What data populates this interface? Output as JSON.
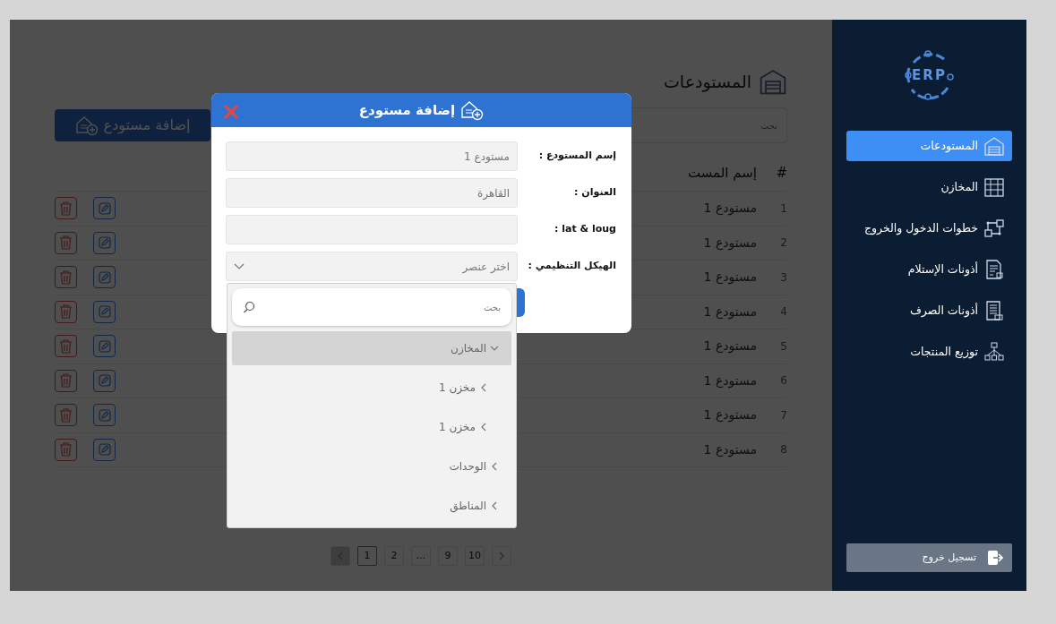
{
  "sidebar": {
    "logo": "ERP",
    "items": [
      {
        "label": "المستودعات",
        "selected": true
      },
      {
        "label": "المخازن",
        "selected": false
      },
      {
        "label": "خطوات الدخول والخروج",
        "selected": false
      },
      {
        "label": "أذونات الإستلام",
        "selected": false
      },
      {
        "label": "أذونات الصرف",
        "selected": false
      },
      {
        "label": "توزيع المنتجات",
        "selected": false
      }
    ],
    "logout": "تسجيل خروج"
  },
  "page": {
    "title": "المستودعات",
    "search_placeholder": "بحث",
    "add_button": "إضافة مستودع"
  },
  "table": {
    "columns": [
      "#",
      "إسم المست"
    ],
    "rows": [
      {
        "index": "1",
        "name": "مستودع 1"
      },
      {
        "index": "2",
        "name": "مستودع 1"
      },
      {
        "index": "3",
        "name": "مستودع 1"
      },
      {
        "index": "4",
        "name": "مستودع 1"
      },
      {
        "index": "5",
        "name": "مستودع 1"
      },
      {
        "index": "6",
        "name": "مستودع 1"
      },
      {
        "index": "7",
        "name": "مستودع 1"
      },
      {
        "index": "8",
        "name": "مستودع 1"
      }
    ]
  },
  "pagination": {
    "prev": {
      "disabled": true
    },
    "next": {
      "disabled": false
    },
    "pages": [
      {
        "label": "10",
        "selected": false
      },
      {
        "label": "9",
        "selected": false
      },
      {
        "label": "...",
        "selected": false
      },
      {
        "label": "2",
        "selected": false
      },
      {
        "label": "1",
        "selected": true
      }
    ]
  },
  "modal": {
    "title": "إضافة مستودع",
    "fields": [
      {
        "kind": "text",
        "label": "إسم المستودع :",
        "placeholder": "مستودع 1"
      },
      {
        "kind": "text",
        "label": "العنوان :",
        "placeholder": "القاهرة"
      },
      {
        "kind": "text",
        "label": "lat & loug :"
      },
      {
        "kind": "select",
        "label": "الهيكل التنظيمي :",
        "placeholder": "اختر عنصر",
        "expanded": true
      }
    ],
    "dropdown": {
      "search_placeholder": "بحث",
      "options": [
        {
          "label": "المخازن",
          "expanded": true,
          "selected": true,
          "children": [
            {
              "label": "مخزن 1",
              "expanded": false,
              "selected": false
            },
            {
              "label": "مخزن 1",
              "expanded": false,
              "selected": false
            }
          ]
        },
        {
          "label": "الوحدات",
          "expanded": false,
          "selected": false
        },
        {
          "label": "المناطق",
          "expanded": false,
          "selected": false
        }
      ]
    }
  }
}
